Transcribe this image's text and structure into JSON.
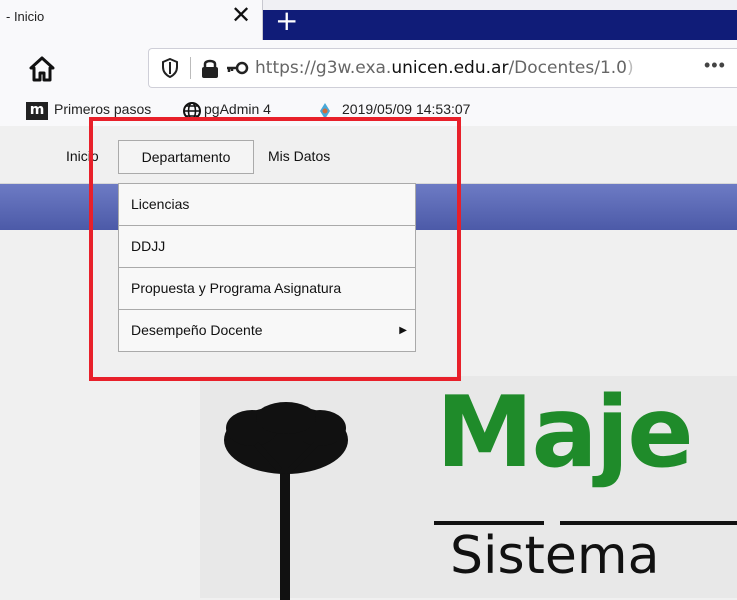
{
  "browser": {
    "tab": {
      "title": "- Inicio",
      "close": "✕"
    },
    "newtab": "+",
    "url": {
      "prefix": "https://g3w.exa.",
      "host": "unicen.edu.ar",
      "path": "/Docentes/1.0",
      "tail": ")"
    },
    "more": "•••",
    "bookmarks": [
      {
        "icon": "m",
        "label": "Primeros pasos"
      },
      {
        "label": "pgAdmin 4"
      },
      {
        "label": "2019/05/09 14:53:07"
      }
    ]
  },
  "site": {
    "nav": [
      "Inicio",
      "Departamento",
      "Mis Datos"
    ],
    "dropdown": [
      "Licencias",
      "DDJJ",
      "Propuesta y Programa Asignatura",
      "Desempeño Docente"
    ],
    "submenu_arrow": "▶",
    "logo": {
      "word": "Maje",
      "subtitle": "Sistema "
    }
  },
  "colors": {
    "highlight": "#e8202a",
    "banner": "#5a68b4",
    "logo_green": "#1f8b2a"
  }
}
